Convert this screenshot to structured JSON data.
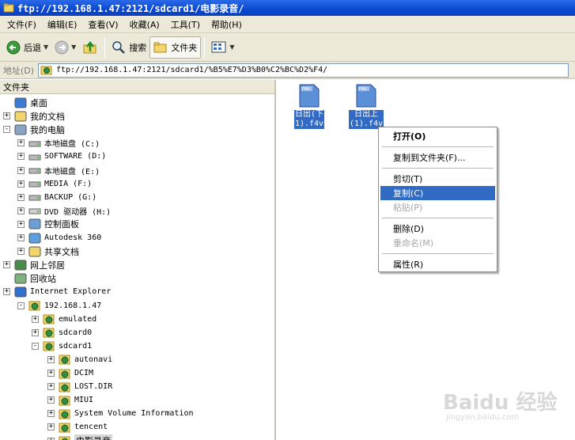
{
  "window": {
    "title": "ftp://192.168.1.47:2121/sdcard1/电影录音/"
  },
  "menu": [
    "文件(F)",
    "编辑(E)",
    "查看(V)",
    "收藏(A)",
    "工具(T)",
    "帮助(H)"
  ],
  "toolbar": {
    "back": "后退",
    "search": "搜索",
    "folders": "文件夹"
  },
  "address": {
    "label": "地址(D)",
    "value": "ftp://192.168.1.47:2121/sdcard1/%B5%E7%D3%B0%C2%BC%D2%F4/"
  },
  "left_pane": {
    "header": "文件夹"
  },
  "tree": [
    {
      "label": "桌面",
      "icon": "desktop-icon",
      "expander": "",
      "mono": false
    },
    {
      "label": "我的文档",
      "icon": "documents-icon",
      "expander": "+",
      "mono": false
    },
    {
      "label": "我的电脑",
      "icon": "computer-icon",
      "expander": "-",
      "mono": false
    },
    {
      "label": "本地磁盘 (C:)",
      "icon": "drive-icon",
      "expander": "+",
      "mono": true
    },
    {
      "label": "SOFTWARE (D:)",
      "icon": "drive-icon",
      "expander": "+",
      "mono": true
    },
    {
      "label": "本地磁盘 (E:)",
      "icon": "drive-icon",
      "expander": "+",
      "mono": true
    },
    {
      "label": "MEDIA (F:)",
      "icon": "drive-icon",
      "expander": "+",
      "mono": true
    },
    {
      "label": "BACKUP (G:)",
      "icon": "drive-icon",
      "expander": "+",
      "mono": true
    },
    {
      "label": "DVD 驱动器 (H:)",
      "icon": "dvd-icon",
      "expander": "+",
      "mono": true
    },
    {
      "label": "控制面板",
      "icon": "control-panel-icon",
      "expander": "+",
      "mono": false
    },
    {
      "label": "Autodesk 360",
      "icon": "cloud-icon",
      "expander": "+",
      "mono": true
    },
    {
      "label": "共享文档",
      "icon": "folder-icon",
      "expander": "+",
      "mono": false
    },
    {
      "label": "网上邻居",
      "icon": "network-icon",
      "expander": "+",
      "mono": false
    },
    {
      "label": "回收站",
      "icon": "recycle-bin-icon",
      "expander": "",
      "mono": false
    },
    {
      "label": "Internet Explorer",
      "icon": "ie-icon",
      "expander": "+",
      "mono": true
    },
    {
      "label": "192.168.1.47",
      "icon": "ftp-server-icon",
      "expander": "-",
      "mono": true
    },
    {
      "label": "emulated",
      "icon": "ftp-folder-icon",
      "expander": "+",
      "mono": true
    },
    {
      "label": "sdcard0",
      "icon": "ftp-folder-icon",
      "expander": "+",
      "mono": true
    },
    {
      "label": "sdcard1",
      "icon": "ftp-folder-icon",
      "expander": "-",
      "mono": true
    },
    {
      "label": "autonavi",
      "icon": "ftp-folder-icon",
      "expander": "+",
      "mono": true
    },
    {
      "label": "DCIM",
      "icon": "ftp-folder-icon",
      "expander": "+",
      "mono": true
    },
    {
      "label": "LOST.DIR",
      "icon": "ftp-folder-icon",
      "expander": "+",
      "mono": true
    },
    {
      "label": "MIUI",
      "icon": "ftp-folder-icon",
      "expander": "+",
      "mono": true
    },
    {
      "label": "System Volume Information",
      "icon": "ftp-folder-icon",
      "expander": "+",
      "mono": true
    },
    {
      "label": "tencent",
      "icon": "ftp-folder-icon",
      "expander": "+",
      "mono": true
    },
    {
      "label": "电影录音",
      "icon": "ftp-folder-icon",
      "expander": "+",
      "mono": false
    }
  ],
  "files": [
    {
      "name_line1": "日出(下",
      "name_line2": "1).f4v",
      "badge": "F4V"
    },
    {
      "name_line1": "日出上",
      "name_line2": "(1).f4v",
      "badge": "F4V"
    }
  ],
  "context_menu": [
    {
      "label": "打开(O)",
      "state": "bold"
    },
    {
      "sep": true
    },
    {
      "label": "复制到文件夹(F)...",
      "state": "normal"
    },
    {
      "sep": true
    },
    {
      "label": "剪切(T)",
      "state": "normal"
    },
    {
      "label": "复制(C)",
      "state": "highlighted"
    },
    {
      "label": "粘贴(P)",
      "state": "disabled"
    },
    {
      "sep": true
    },
    {
      "label": "删除(D)",
      "state": "normal"
    },
    {
      "label": "重命名(M)",
      "state": "disabled"
    },
    {
      "sep": true
    },
    {
      "label": "属性(R)",
      "state": "normal"
    }
  ],
  "watermark": {
    "text": "Baidu 经验",
    "sub": "jingyan.baidu.com"
  },
  "colors": {
    "title_bar": "#0a48d0",
    "selection": "#316ac5",
    "chrome": "#ece9d8"
  }
}
